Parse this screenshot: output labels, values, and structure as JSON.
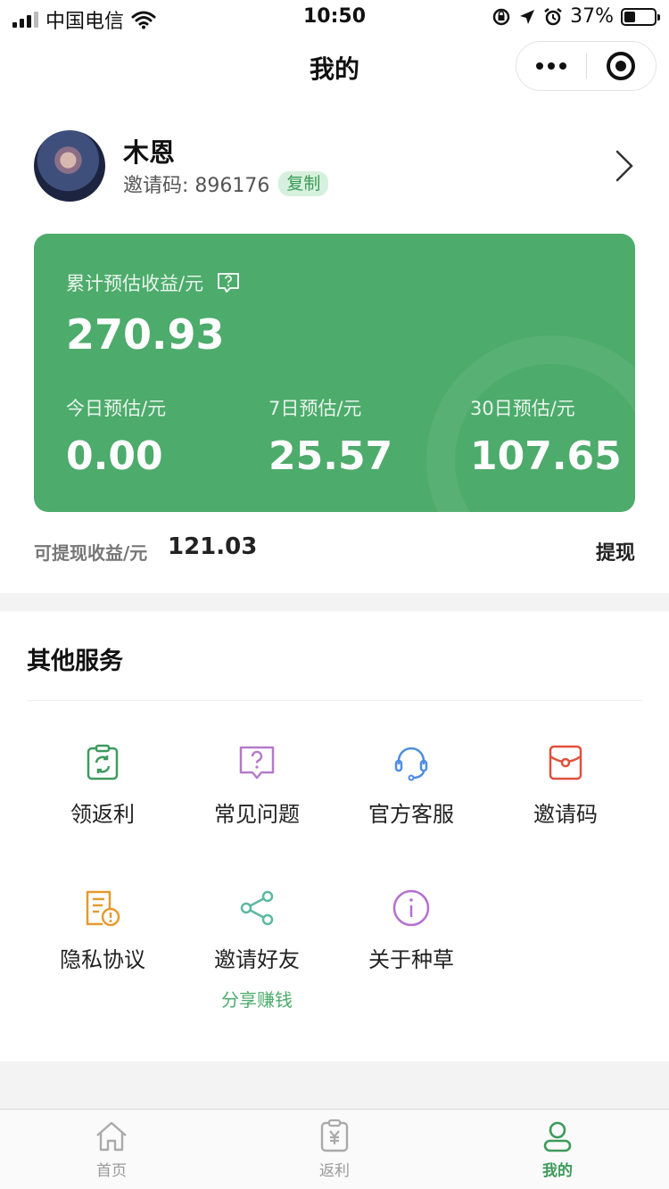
{
  "status_bar": {
    "carrier": "中国电信",
    "time": "10:50",
    "battery": "37%"
  },
  "nav": {
    "title": "我的"
  },
  "profile": {
    "name": "木恩",
    "invite_label": "邀请码: 896176",
    "copy_label": "复制"
  },
  "earnings": {
    "total_label": "累计预估收益/元",
    "total_value": "270.93",
    "today_label": "今日预估/元",
    "today_value": "0.00",
    "week_label": "7日预估/元",
    "week_value": "25.57",
    "month_label": "30日预估/元",
    "month_value": "107.65"
  },
  "withdraw": {
    "label": "可提现收益/元",
    "value": "121.03",
    "button": "提现"
  },
  "services": {
    "title": "其他服务",
    "items": [
      {
        "label": "领返利",
        "icon": "rebate-icon",
        "color": "#3f9a5e"
      },
      {
        "label": "常见问题",
        "icon": "faq-icon",
        "color": "#b57ac9"
      },
      {
        "label": "官方客服",
        "icon": "headset-icon",
        "color": "#4f8de0"
      },
      {
        "label": "邀请码",
        "icon": "red-envelope-icon",
        "color": "#e0503a"
      },
      {
        "label": "隐私协议",
        "icon": "privacy-doc-icon",
        "color": "#e6992e"
      },
      {
        "label": "邀请好友",
        "icon": "share-icon",
        "color": "#5cb8a0",
        "sub": "分享赚钱"
      },
      {
        "label": "关于种草",
        "icon": "info-icon",
        "color": "#b56fd0"
      }
    ]
  },
  "tabs": [
    {
      "label": "首页",
      "icon": "home-icon"
    },
    {
      "label": "返利",
      "icon": "rebate-tab-icon"
    },
    {
      "label": "我的",
      "icon": "profile-icon",
      "active": true
    }
  ],
  "colors": {
    "accent": "#4dab6b",
    "tab_active": "#3d9a5a"
  }
}
